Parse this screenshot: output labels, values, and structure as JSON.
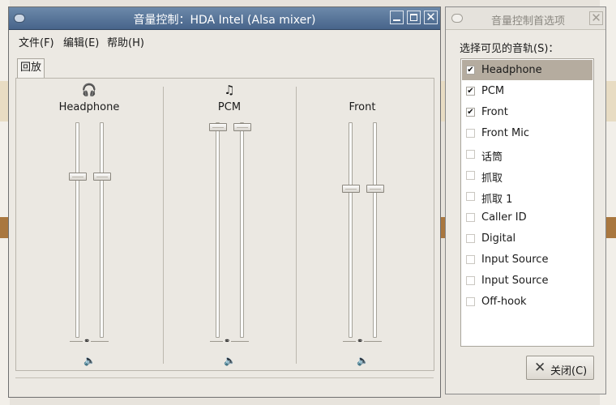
{
  "mixer": {
    "title": "音量控制：HDA Intel (Alsa mixer)",
    "menu": [
      "文件(F)",
      "编辑(E)",
      "帮助(H)"
    ],
    "tab": "回放",
    "channels": [
      {
        "name": "Headphone",
        "icon": "headphone-icon",
        "glyph": "🎧",
        "level": 0.76
      },
      {
        "name": "PCM",
        "icon": "music-note-icon",
        "glyph": "♫",
        "level": 1.0
      },
      {
        "name": "Front",
        "icon": "",
        "glyph": "",
        "level": 0.7
      }
    ],
    "lock_glyph": "⚭",
    "speaker_glyph": "🔈"
  },
  "prefs": {
    "title": "音量控制首选项",
    "label": "选择可见的音轨(S)：",
    "tracks": [
      {
        "label": "Headphone",
        "checked": true,
        "selected": true
      },
      {
        "label": "PCM",
        "checked": true
      },
      {
        "label": "Front",
        "checked": true
      },
      {
        "label": "Front Mic",
        "checked": false
      },
      {
        "label": "话筒",
        "checked": false
      },
      {
        "label": "抓取",
        "checked": false
      },
      {
        "label": "抓取 1",
        "checked": false
      },
      {
        "label": "Caller ID",
        "checked": false
      },
      {
        "label": "Digital",
        "checked": false
      },
      {
        "label": "Input Source",
        "checked": false
      },
      {
        "label": "Input Source",
        "checked": false
      },
      {
        "label": "Off-hook",
        "checked": false
      }
    ],
    "close_label": "关闭(C)"
  },
  "colors": {
    "titlebar_active": "#47648a",
    "selection": "#b5ac9f",
    "window_bg": "#ece9e3"
  }
}
